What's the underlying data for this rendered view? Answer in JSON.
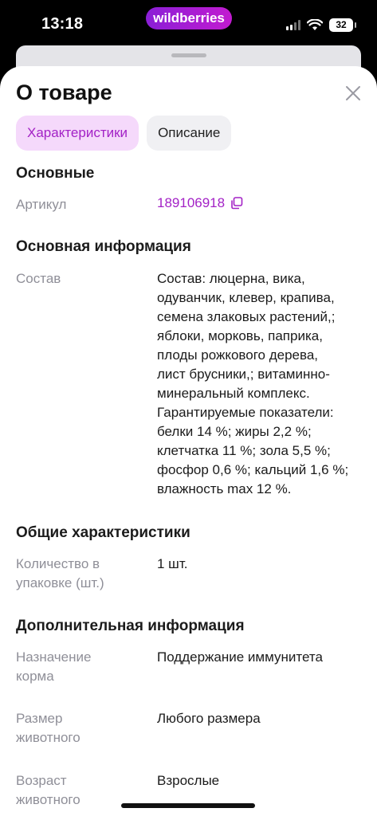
{
  "status_bar": {
    "time": "13:18",
    "brand": "wildberries",
    "battery": "32"
  },
  "sheet": {
    "title": "О товаре"
  },
  "tabs": [
    {
      "label": "Характеристики",
      "active": true
    },
    {
      "label": "Описание",
      "active": false
    }
  ],
  "sections": {
    "main": {
      "title": "Основные",
      "article_label": "Артикул",
      "article_value": "189106918"
    },
    "info": {
      "title": "Основная информация",
      "composition_label": "Состав",
      "composition_lines": [
        "Состав: люцерна, вика,",
        "одуванчик, клевер, крапива,",
        "семена злаковых растений,;",
        "яблоки, морковь, паприка,",
        "плоды рожкового дерева,",
        "лист брусники,; витаминно-",
        "минеральный комплекс.",
        "Гарантируемые показатели:",
        "белки 14 %; жиры 2,2 %;",
        "клетчатка 11 %; зола 5,5 %;",
        "фосфор 0,6 %; кальций 1,6 %;",
        "влажность max 12 %."
      ]
    },
    "general": {
      "title": "Общие характеристики",
      "qty_label_lines": [
        "Количество в",
        "упаковке (шт.)"
      ],
      "qty_value": "1 шт."
    },
    "extra": {
      "title": "Дополнительная информация",
      "purpose_label_lines": [
        "Назначение",
        "корма"
      ],
      "purpose_value": "Поддержание иммунитета",
      "size_label_lines": [
        "Размер",
        "животного"
      ],
      "size_value": "Любого размера",
      "age_label_lines": [
        "Возраст",
        "животного"
      ],
      "age_value": "Взрослые"
    }
  },
  "colors": {
    "accent": "#a322c6",
    "accent_bg": "#f5d9fb",
    "label": "#8f8f98",
    "brand_from": "#8a1fd6",
    "brand_to": "#c21bd0"
  },
  "icons": {
    "close": "close-icon",
    "copy": "copy-icon",
    "wifi": "wifi-icon",
    "signal": "cellular-signal-icon",
    "battery": "battery-icon"
  }
}
